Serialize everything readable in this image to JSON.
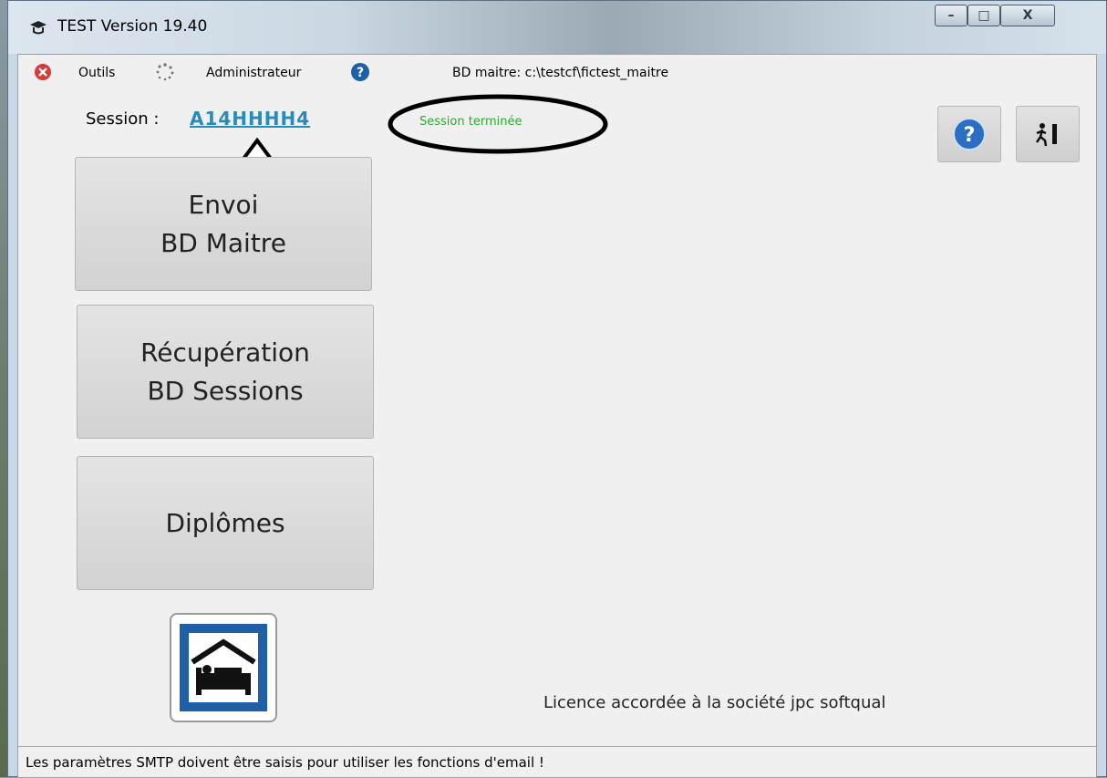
{
  "window": {
    "title": "TEST Version 19.40",
    "controls": {
      "minimize": "–",
      "maximize": "□",
      "close": "X"
    }
  },
  "menu": {
    "items": [
      {
        "icon": "close-red-icon",
        "label": ""
      },
      {
        "icon": "",
        "label": "Outils"
      },
      {
        "icon": "loading-spinner-icon",
        "label": ""
      },
      {
        "icon": "",
        "label": "Administrateur"
      },
      {
        "icon": "help-blue-icon",
        "label": ""
      }
    ],
    "bd_path": "BD maitre: c:\\testcf\\fictest_maitre"
  },
  "session": {
    "label": "Session :",
    "code": "A14HHHH4",
    "status": "Session terminée"
  },
  "buttons": {
    "envoi": {
      "line1": "Envoi",
      "line2": "BD Maitre"
    },
    "recuperation": {
      "line1": "Récupération",
      "line2": "BD Sessions"
    },
    "diplomes": {
      "label": "Diplômes"
    }
  },
  "logo": {
    "icon": "hotel-bed-icon"
  },
  "toolbar_right": {
    "help_icon": "help-icon",
    "exit_icon": "exit-icon"
  },
  "licence": "Licence accordée à la société  jpc softqual",
  "status_bar": "Les paramètres SMTP doivent être saisis pour utiliser les fonctions d'email  !",
  "colors": {
    "session_link": "#2a8ab8",
    "status_green": "#2fa82f",
    "accent_blue": "#1f5fa8"
  }
}
